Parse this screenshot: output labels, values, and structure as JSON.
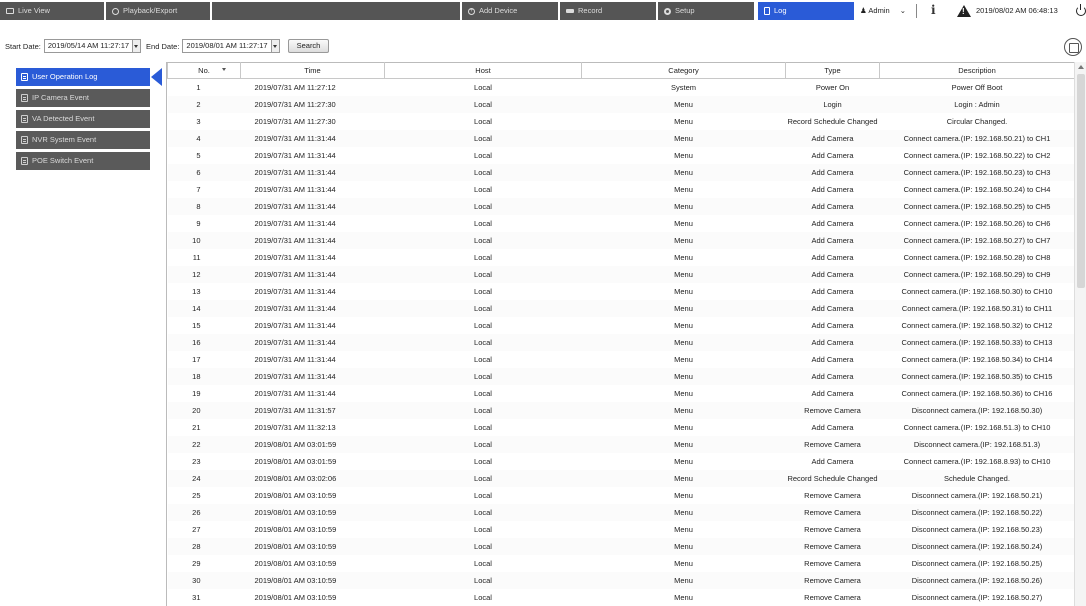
{
  "topbar": {
    "tabs": [
      {
        "label": "Live View",
        "icon": "monitor-icon",
        "active": false
      },
      {
        "label": "Playback/Export",
        "icon": "play-circle-icon",
        "active": false
      },
      {
        "label": "Add Device",
        "icon": "add-circle-icon",
        "active": false
      },
      {
        "label": "Record",
        "icon": "record-icon",
        "active": false
      },
      {
        "label": "Setup",
        "icon": "gear-icon",
        "active": false
      },
      {
        "label": "Log",
        "icon": "document-icon",
        "active": true
      }
    ],
    "user": "Admin",
    "user_icon": "user-icon",
    "datetime": "2019/08/02 AM 06:48:13",
    "colors": {
      "bar": "#555555",
      "active": "#2a5bd7"
    }
  },
  "search": {
    "start_label": "Start Date:",
    "start_value": "2019/05/14 AM 11:27:17",
    "end_label": "End Date:",
    "end_value": "2019/08/01 AM 11:27:17",
    "button_label": "Search"
  },
  "sidebar": {
    "items": [
      {
        "label": "User Operation Log",
        "active": true
      },
      {
        "label": "IP Camera Event",
        "active": false
      },
      {
        "label": "VA Detected Event",
        "active": false
      },
      {
        "label": "NVR System Event",
        "active": false
      },
      {
        "label": "POE Switch Event",
        "active": false
      }
    ]
  },
  "table": {
    "columns": [
      "No.",
      "Time",
      "Host",
      "Category",
      "Type",
      "Description"
    ],
    "rows": [
      [
        "1",
        "2019/07/31 AM 11:27:12",
        "Local",
        "System",
        "Power On",
        "Power Off Boot"
      ],
      [
        "2",
        "2019/07/31 AM 11:27:30",
        "Local",
        "Menu",
        "Login",
        "Login : Admin"
      ],
      [
        "3",
        "2019/07/31 AM 11:27:30",
        "Local",
        "Menu",
        "Record Schedule Changed",
        "Circular Changed."
      ],
      [
        "4",
        "2019/07/31 AM 11:31:44",
        "Local",
        "Menu",
        "Add Camera",
        "Connect camera.(IP: 192.168.50.21) to CH1"
      ],
      [
        "5",
        "2019/07/31 AM 11:31:44",
        "Local",
        "Menu",
        "Add Camera",
        "Connect camera.(IP: 192.168.50.22) to CH2"
      ],
      [
        "6",
        "2019/07/31 AM 11:31:44",
        "Local",
        "Menu",
        "Add Camera",
        "Connect camera.(IP: 192.168.50.23) to CH3"
      ],
      [
        "7",
        "2019/07/31 AM 11:31:44",
        "Local",
        "Menu",
        "Add Camera",
        "Connect camera.(IP: 192.168.50.24) to CH4"
      ],
      [
        "8",
        "2019/07/31 AM 11:31:44",
        "Local",
        "Menu",
        "Add Camera",
        "Connect camera.(IP: 192.168.50.25) to CH5"
      ],
      [
        "9",
        "2019/07/31 AM 11:31:44",
        "Local",
        "Menu",
        "Add Camera",
        "Connect camera.(IP: 192.168.50.26) to CH6"
      ],
      [
        "10",
        "2019/07/31 AM 11:31:44",
        "Local",
        "Menu",
        "Add Camera",
        "Connect camera.(IP: 192.168.50.27) to CH7"
      ],
      [
        "11",
        "2019/07/31 AM 11:31:44",
        "Local",
        "Menu",
        "Add Camera",
        "Connect camera.(IP: 192.168.50.28) to CH8"
      ],
      [
        "12",
        "2019/07/31 AM 11:31:44",
        "Local",
        "Menu",
        "Add Camera",
        "Connect camera.(IP: 192.168.50.29) to CH9"
      ],
      [
        "13",
        "2019/07/31 AM 11:31:44",
        "Local",
        "Menu",
        "Add Camera",
        "Connect camera.(IP: 192.168.50.30) to CH10"
      ],
      [
        "14",
        "2019/07/31 AM 11:31:44",
        "Local",
        "Menu",
        "Add Camera",
        "Connect camera.(IP: 192.168.50.31) to CH11"
      ],
      [
        "15",
        "2019/07/31 AM 11:31:44",
        "Local",
        "Menu",
        "Add Camera",
        "Connect camera.(IP: 192.168.50.32) to CH12"
      ],
      [
        "16",
        "2019/07/31 AM 11:31:44",
        "Local",
        "Menu",
        "Add Camera",
        "Connect camera.(IP: 192.168.50.33) to CH13"
      ],
      [
        "17",
        "2019/07/31 AM 11:31:44",
        "Local",
        "Menu",
        "Add Camera",
        "Connect camera.(IP: 192.168.50.34) to CH14"
      ],
      [
        "18",
        "2019/07/31 AM 11:31:44",
        "Local",
        "Menu",
        "Add Camera",
        "Connect camera.(IP: 192.168.50.35) to CH15"
      ],
      [
        "19",
        "2019/07/31 AM 11:31:44",
        "Local",
        "Menu",
        "Add Camera",
        "Connect camera.(IP: 192.168.50.36) to CH16"
      ],
      [
        "20",
        "2019/07/31 AM 11:31:57",
        "Local",
        "Menu",
        "Remove Camera",
        "Disconnect camera.(IP: 192.168.50.30)"
      ],
      [
        "21",
        "2019/07/31 AM 11:32:13",
        "Local",
        "Menu",
        "Add Camera",
        "Connect camera.(IP: 192.168.51.3) to CH10"
      ],
      [
        "22",
        "2019/08/01 AM 03:01:59",
        "Local",
        "Menu",
        "Remove Camera",
        "Disconnect camera.(IP: 192.168.51.3)"
      ],
      [
        "23",
        "2019/08/01 AM 03:01:59",
        "Local",
        "Menu",
        "Add Camera",
        "Connect camera.(IP: 192.168.8.93) to CH10"
      ],
      [
        "24",
        "2019/08/01 AM 03:02:06",
        "Local",
        "Menu",
        "Record Schedule Changed",
        "Schedule Changed."
      ],
      [
        "25",
        "2019/08/01 AM 03:10:59",
        "Local",
        "Menu",
        "Remove Camera",
        "Disconnect camera.(IP: 192.168.50.21)"
      ],
      [
        "26",
        "2019/08/01 AM 03:10:59",
        "Local",
        "Menu",
        "Remove Camera",
        "Disconnect camera.(IP: 192.168.50.22)"
      ],
      [
        "27",
        "2019/08/01 AM 03:10:59",
        "Local",
        "Menu",
        "Remove Camera",
        "Disconnect camera.(IP: 192.168.50.23)"
      ],
      [
        "28",
        "2019/08/01 AM 03:10:59",
        "Local",
        "Menu",
        "Remove Camera",
        "Disconnect camera.(IP: 192.168.50.24)"
      ],
      [
        "29",
        "2019/08/01 AM 03:10:59",
        "Local",
        "Menu",
        "Remove Camera",
        "Disconnect camera.(IP: 192.168.50.25)"
      ],
      [
        "30",
        "2019/08/01 AM 03:10:59",
        "Local",
        "Menu",
        "Remove Camera",
        "Disconnect camera.(IP: 192.168.50.26)"
      ],
      [
        "31",
        "2019/08/01 AM 03:10:59",
        "Local",
        "Menu",
        "Remove Camera",
        "Disconnect camera.(IP: 192.168.50.27)"
      ]
    ]
  }
}
